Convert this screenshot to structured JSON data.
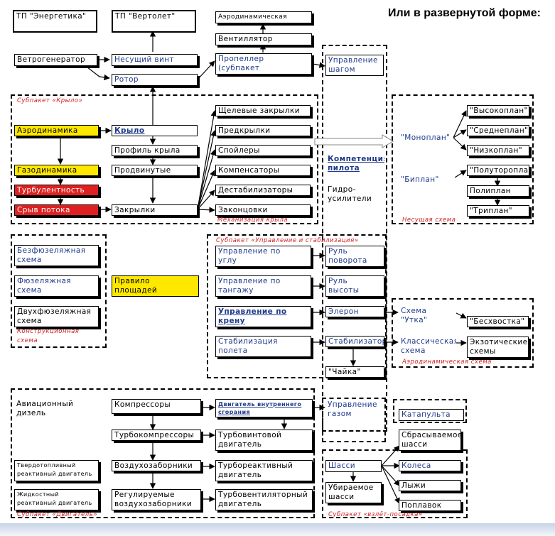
{
  "title": "Или в развернутой форме:",
  "boxes": {
    "tp_energetika": "ТП \"Энергетика\"",
    "tp_vertolet": "ТП \"Вертолет\"",
    "aero_truba": "Аэродинамическая труба",
    "ventilyator": "Вентиллятор",
    "vetrogenerator": "Ветрогенератор",
    "nesushchiy_vint": "Несущий винт",
    "rotor": "Ротор",
    "propeller": "Пропеллер\n(субпакет Движитель\")",
    "upr_shagom": "Управление\nшагом винта",
    "aerodinamika": "Аэродинамика",
    "krylo": "Крыло",
    "profil": "Профиль крыла",
    "gazodinamika": "Газодинамика",
    "prodvinutye": "Продвинутые профили",
    "turbulentnost": "Турбулентность",
    "sryv": "Срыв потока",
    "zakrylki": "Закрылки",
    "shchelevye": "Щелевые закрылки",
    "predkrylki": "Предкрылки",
    "spoylery": "Спойлеры",
    "kompensatory": "Компенсаторы",
    "destabilizatory": "Дестабилизаторы",
    "zakontsovki": "Законцовки",
    "kompetentsiya": "Компетенция\nпилота",
    "gidro": "Гидро-\nусилители",
    "monoplan": "\"Моноплан\"",
    "vysokoplan": "\"Высокоплан\"",
    "sredneplan": "\"Среднеплан\"",
    "nizkoplan": "\"Низкоплан\"",
    "biplan": "\"Биплан\"",
    "poluto": "\"Полутороплан\"",
    "poliplan": "Полиплан",
    "triplan": "\"Триплан\"",
    "bezfuz": "Безфюзеляжная\nсхема",
    "fuz": "Фюзеляжная\nсхема",
    "dvuhfuz": "Двухфюзеляжная\nсхема",
    "pravilo": "Правило\nплощадей",
    "upr_uglu": "Управление по\nуглу",
    "rul_povorota": "Руль\nповорота",
    "upr_tangazhu": "Управление по\nтангажу",
    "rul_vysoty": "Руль\nвысоты",
    "upr_krenu": "Управление по\nкрену",
    "eleron": "Элерон",
    "stab_poleta": "Стабилизация\nполета",
    "stabilizator": "Стабилизатор",
    "chayka": "\"Чайка\"",
    "utka": "Схема\n\"Утка\"",
    "beshvostka": "\"Бесхвостка\"",
    "klassich": "Классическая\nсхема",
    "ekzotich": "Экзотические\nсхемы",
    "aviadizel": "Авиационный\nдизель",
    "kompressory": "Компрессоры",
    "dvs": "Двигатель внутреннего\nсгорания",
    "upr_gazom": "Управление\nгазом",
    "turbokompr": "Турбокомпрессоры",
    "turbovint": "Турбовинтовой\nдвигатель",
    "tverdotopl": "Твердотопливный\nреактивный двигатель",
    "vozduhozab": "Воздухозаборники",
    "turboreakt": "Турбореактивный\nдвигатель",
    "zhidkost": "Жидкостный\nреактивный двигатель",
    "regul": "Регулируемые\nвоздухозаборники",
    "turbovent": "Турбовентиляторный\nдвигатель",
    "katapulta": "Катапульта",
    "sbras": "Сбрасываемое\nшасси",
    "shassi": "Шасси",
    "kolesa": "Колеса",
    "lyzhi": "Лыжи",
    "ubir": "Убираемое\nшасси",
    "poplavok": "Поплавок"
  },
  "labels": {
    "krylo_pkg": "Субпакет «Крыло»",
    "mehanizatsiya": "Механизация крыла",
    "nesushchaya": "Несущая схема",
    "upr_stab": "Субпакет «Управление и стабилизация»",
    "konstr": "Конструкционная\nсхема",
    "aero_shema": "Аэродинамическая схема",
    "dvigatel_pkg": "Субпакет «Двигатель»",
    "vzlet": "Субпакет «взлёт-посадка»"
  }
}
